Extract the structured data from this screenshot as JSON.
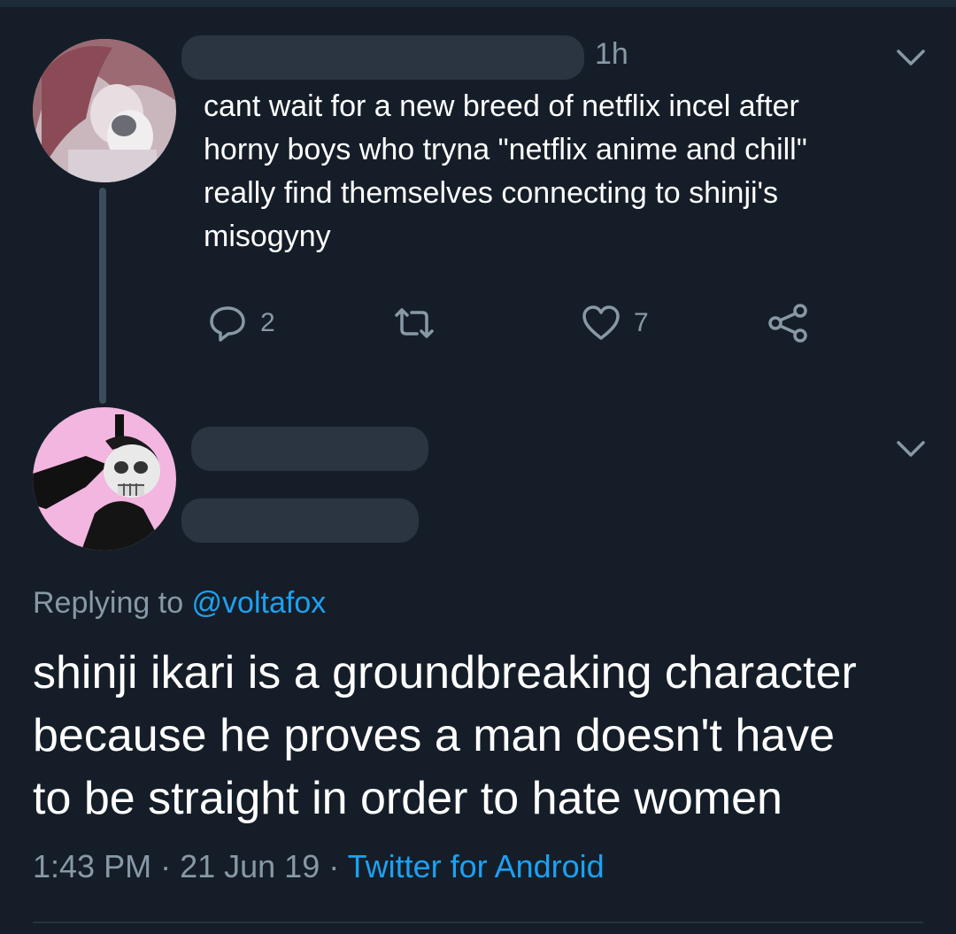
{
  "tweet1": {
    "time": "1h",
    "text": "cant wait for a new breed of netflix incel after\nhorny boys who tryna \"netflix anime and chill\"\nreally find themselves connecting to shinji's\nmisogyny",
    "reply_count": "2",
    "like_count": "7",
    "icons": [
      "reply-icon",
      "retweet-icon",
      "like-icon",
      "share-icon",
      "chevron-down-icon"
    ]
  },
  "tweet2": {
    "replying_prefix": "Replying to ",
    "replying_handle": "@voltafox",
    "text": "shinji ikari is a groundbreaking character\nbecause he proves a man doesn't have\nto be straight in order to hate women",
    "time": "1:43 PM",
    "separator": " · ",
    "date": "21 Jun 19",
    "source": "Twitter for Android"
  },
  "colors": {
    "background": "#151e28",
    "secondary_text": "#8899a6",
    "link": "#1da1f2",
    "redaction": "#2b3541"
  }
}
